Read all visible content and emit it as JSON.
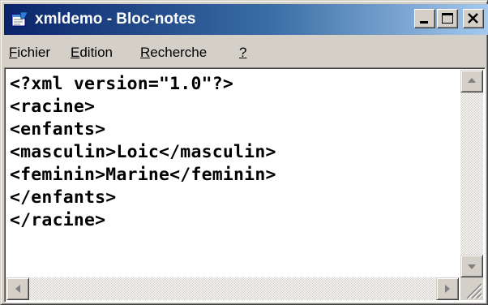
{
  "window": {
    "title": "xmldemo - Bloc-notes",
    "app_icon": "notepad-icon",
    "controls": [
      "minimize-icon",
      "maximize-icon",
      "close-icon"
    ]
  },
  "menu": {
    "file": {
      "accel": "F",
      "rest": "ichier"
    },
    "edit": {
      "accel": "E",
      "rest": "dition"
    },
    "search": {
      "accel": "R",
      "rest": "echerche"
    },
    "help": {
      "accel": "?",
      "rest": ""
    }
  },
  "document": {
    "lines": [
      "<?xml version=\"1.0\"?>",
      "<racine>",
      "<enfants>",
      "<masculin>Loic</masculin>",
      "<feminin>Marine</feminin>",
      "</enfants>",
      "</racine>"
    ]
  },
  "colors": {
    "titlebar_start": "#0a246a",
    "titlebar_end": "#a6caf0",
    "face": "#d4d0c8",
    "editor_bg": "#ffffff"
  }
}
